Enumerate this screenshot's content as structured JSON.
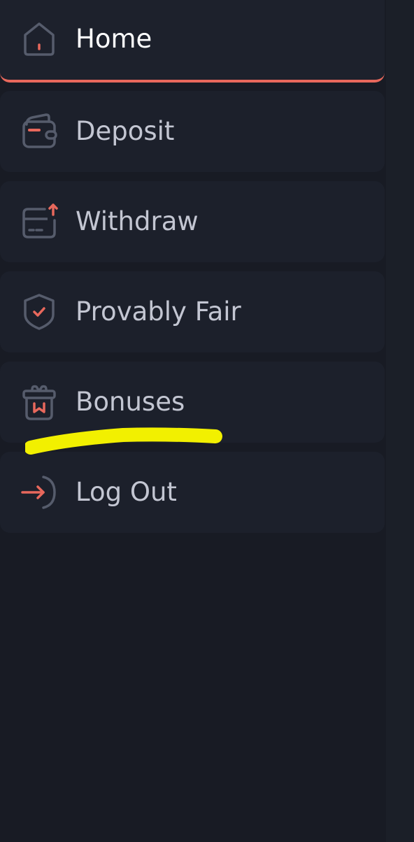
{
  "menu": {
    "items": [
      {
        "label": "Home",
        "icon": "home-icon",
        "active": true
      },
      {
        "label": "Deposit",
        "icon": "wallet-icon",
        "active": false
      },
      {
        "label": "Withdraw",
        "icon": "card-withdraw-icon",
        "active": false
      },
      {
        "label": "Provably Fair",
        "icon": "shield-check-icon",
        "active": false
      },
      {
        "label": "Bonuses",
        "icon": "gift-icon",
        "active": false
      },
      {
        "label": "Log Out",
        "icon": "logout-icon",
        "active": false
      }
    ]
  },
  "colors": {
    "background": "#181b24",
    "item_background": "#1c202b",
    "accent": "#e8685c",
    "icon_stroke": "#565c6c",
    "label": "#c3c6d2",
    "active_label": "#ffffff",
    "marker_highlight": "#f2f000"
  }
}
